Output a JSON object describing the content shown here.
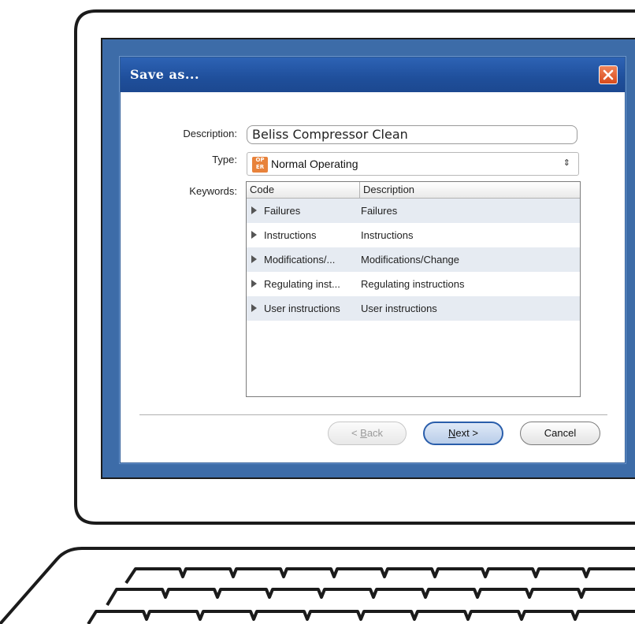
{
  "dialog": {
    "title": "Save as...",
    "description_label": "Description:",
    "description_value": "Beliss Compressor Clean",
    "type_label": "Type:",
    "type_icon_text": [
      "OP",
      "ER"
    ],
    "type_value": "Normal Operating",
    "keywords_label": "Keywords:",
    "keywords_table": {
      "columns": [
        "Code",
        "Description"
      ],
      "rows": [
        {
          "code": "Failures",
          "description": "Failures"
        },
        {
          "code": "Instructions",
          "description": "Instructions"
        },
        {
          "code": "Modifications/...",
          "description": "Modifications/Change"
        },
        {
          "code": "Regulating inst...",
          "description": "Regulating instructions"
        },
        {
          "code": "User instructions",
          "description": "User instructions"
        }
      ]
    },
    "buttons": {
      "back_prefix": "< ",
      "back_mnemonic": "B",
      "back_rest": "ack",
      "next_mnemonic": "N",
      "next_rest": "ext >",
      "cancel": "Cancel"
    }
  },
  "colors": {
    "screen_bg": "#3d6ca8",
    "titlebar": "#2d63b5",
    "close_button": "#d84a1b",
    "row_alt": "#e6ebf2",
    "type_icon": "#e8823a"
  },
  "icons": {
    "close": "close-x-icon",
    "type": "operating-type-icon",
    "dropdown": "updown-arrow-icon",
    "row_expand": "triangle-right-icon"
  }
}
